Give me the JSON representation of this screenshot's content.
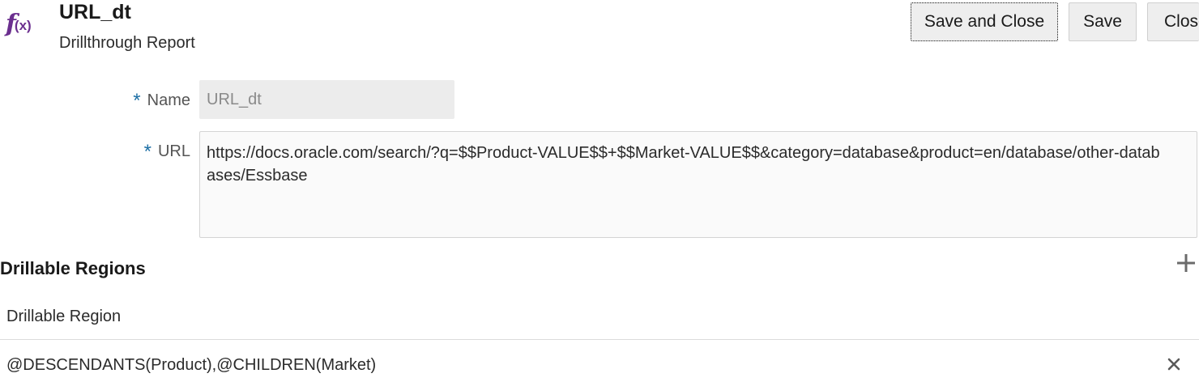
{
  "header": {
    "icon": "fx-icon",
    "icon_text": "f",
    "icon_sub": "(x)",
    "title": "URL_dt",
    "subtitle": "Drillthrough Report"
  },
  "toolbar": {
    "save_close_label": "Save and Close",
    "save_label": "Save",
    "close_label": "Close"
  },
  "form": {
    "required_marker": "*",
    "name_label": "Name",
    "name_value": "URL_dt",
    "url_label": "URL",
    "url_value": "https://docs.oracle.com/search/?q=$$Product-VALUE$$+$$Market-VALUE$$&category=database&product=en/database/other-databases/Essbase"
  },
  "regions": {
    "heading": "Drillable Regions",
    "add_icon": "plus-icon",
    "column_header": "Drillable Region",
    "rows": [
      {
        "value": "@DESCENDANTS(Product),@CHILDREN(Market)",
        "remove_icon": "close-icon"
      }
    ]
  },
  "colors": {
    "accent_purple": "#6b2f8f",
    "required_blue": "#1d6fa5",
    "button_bg": "#eeeeee"
  }
}
